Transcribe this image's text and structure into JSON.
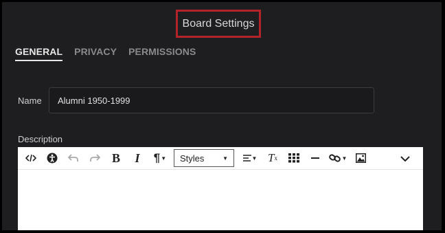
{
  "dialog": {
    "title": "Board Settings"
  },
  "tabs": [
    {
      "label": "GENERAL",
      "active": true
    },
    {
      "label": "PRIVACY",
      "active": false
    },
    {
      "label": "PERMISSIONS",
      "active": false
    }
  ],
  "form": {
    "name_label": "Name",
    "name_value": "Alumni 1950-1999",
    "description_label": "Description"
  },
  "toolbar": {
    "styles_label": "Styles",
    "icons": [
      "source-code-icon",
      "accessibility-icon",
      "undo-icon",
      "redo-icon",
      "bold-icon",
      "italic-icon",
      "paragraph-icon",
      "styles-dropdown",
      "align-icon",
      "clear-format-icon",
      "table-icon",
      "horizontal-rule-icon",
      "link-icon",
      "image-icon",
      "more-icon"
    ]
  },
  "colors": {
    "highlight_border": "#b3242a",
    "background": "#1e1e20"
  }
}
